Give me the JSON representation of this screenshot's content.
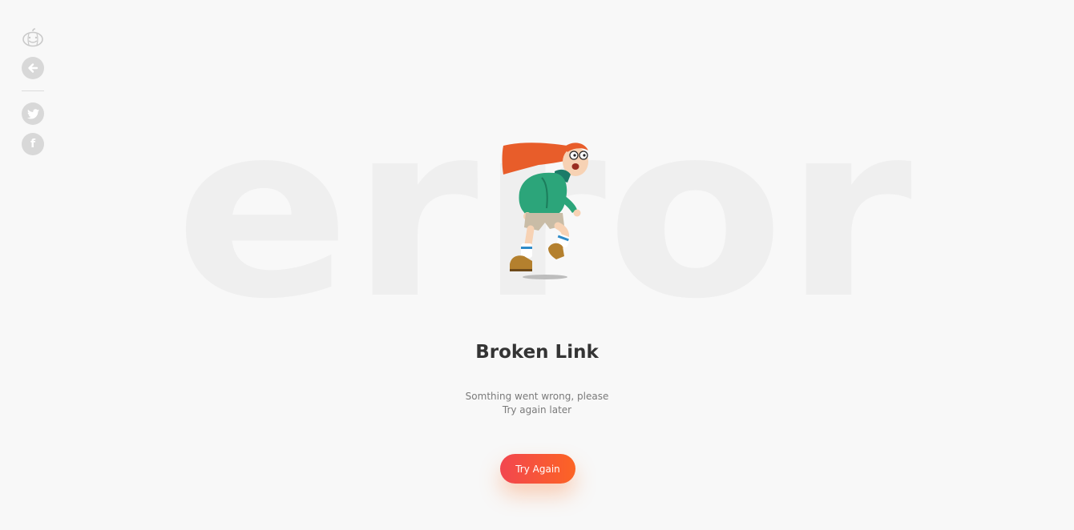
{
  "background_word": "error",
  "icons": {
    "logo": "pumpkin-logo-icon",
    "back": "arrow-left-icon",
    "twitter": "twitter-icon",
    "facebook": "facebook-icon",
    "facebook_glyph": "f"
  },
  "illustration": "running-girl-illustration",
  "error": {
    "title": "Broken Link",
    "message_line1": "Somthing went wrong, please",
    "message_line2": "Try again later"
  },
  "button": {
    "label": "Try Again"
  },
  "colors": {
    "background": "#f8f8f8",
    "accent_start": "#f2464f",
    "accent_end": "#fc6424",
    "title": "#343434",
    "icon_bg": "#d8d8d8"
  }
}
